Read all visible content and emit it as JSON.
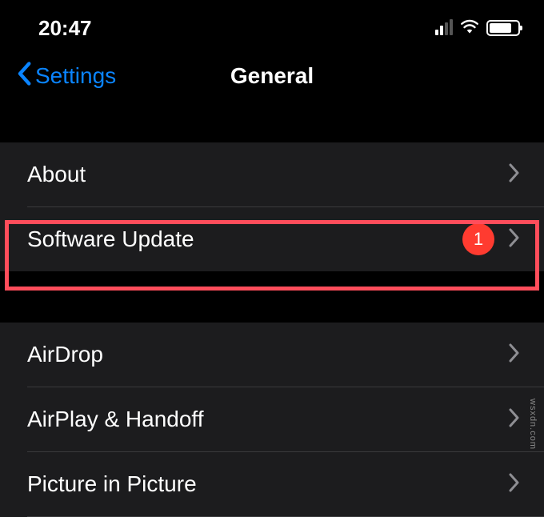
{
  "status": {
    "time": "20:47"
  },
  "nav": {
    "back_label": "Settings",
    "title": "General"
  },
  "group1": {
    "items": [
      {
        "label": "About"
      },
      {
        "label": "Software Update",
        "badge": "1"
      }
    ]
  },
  "group2": {
    "items": [
      {
        "label": "AirDrop"
      },
      {
        "label": "AirPlay & Handoff"
      },
      {
        "label": "Picture in Picture"
      }
    ]
  },
  "watermark": "wsxdn.com"
}
